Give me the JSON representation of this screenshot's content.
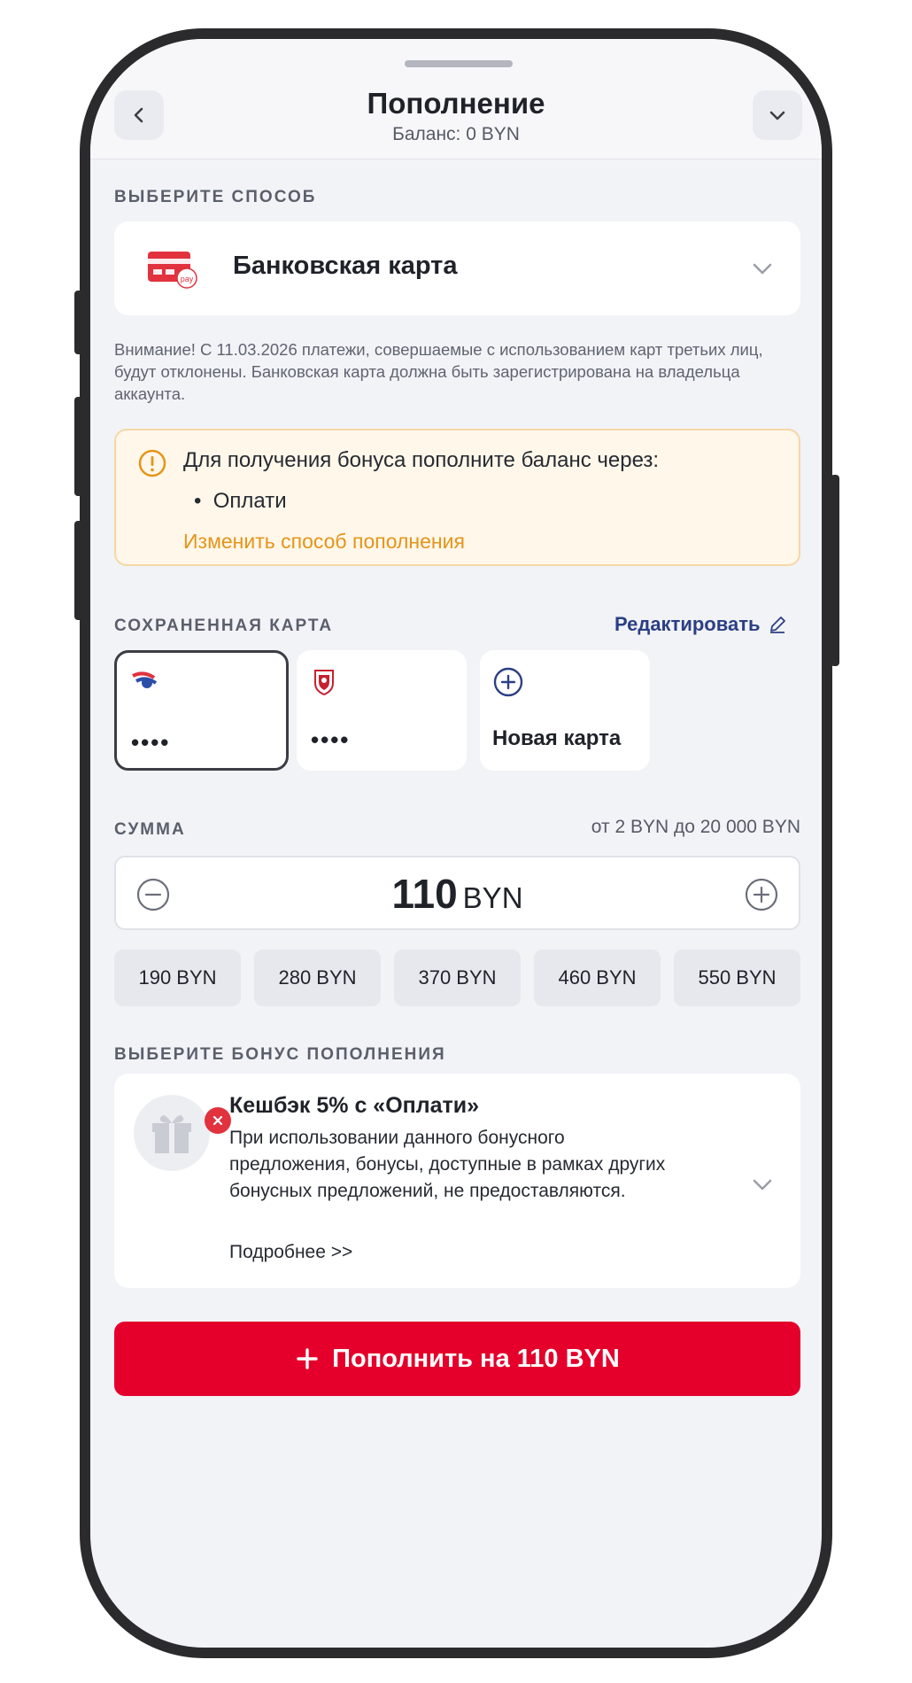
{
  "header": {
    "title": "Пополнение",
    "subtitle": "Баланс: 0 BYN"
  },
  "method": {
    "section_label": "ВЫБЕРИТЕ СПОСОБ",
    "selected": "Банковская карта",
    "card_icon_text": "pay",
    "warning": "Внимание! С 11.03.2026 платежи, совершаемые с использованием карт третьих лиц, будут отклонены. Банковская карта должна быть зарегистрирована на владельца аккаунта."
  },
  "notice": {
    "title": "Для получения бонуса пополните баланс через:",
    "bullet": "Оплати",
    "link": "Изменить способ пополнения"
  },
  "saved_cards": {
    "section_label": "СОХРАНЕННАЯ КАРТА",
    "edit_label": "Редактировать",
    "cards": [
      {
        "masked": "••••",
        "selected": true,
        "icon": "bank-logo-bird-icon"
      },
      {
        "masked": "••••",
        "selected": false,
        "icon": "bank-logo-shield-icon"
      }
    ],
    "new_card_label": "Новая карта"
  },
  "amount": {
    "section_label": "СУММА",
    "range": "от 2 BYN до 20 000 BYN",
    "value": "110",
    "currency": "BYN",
    "presets": [
      "190 BYN",
      "280 BYN",
      "370 BYN",
      "460 BYN",
      "550 BYN"
    ]
  },
  "bonus": {
    "section_label": "ВЫБЕРИТЕ БОНУС ПОПОЛНЕНИЯ",
    "title": "Кешбэк 5% с «Оплати»",
    "description": "При использовании данного бонусного предложения, бонусы, доступные в рамках других бонусных предложений, не предоставляются.",
    "more": "Подробнее >>"
  },
  "submit": {
    "label": "Пополнить на 110 BYN"
  },
  "colors": {
    "accent_red": "#e4002b",
    "link_blue": "#2c3f84",
    "notice_orange": "#e59418",
    "background": "#f2f3f7"
  }
}
